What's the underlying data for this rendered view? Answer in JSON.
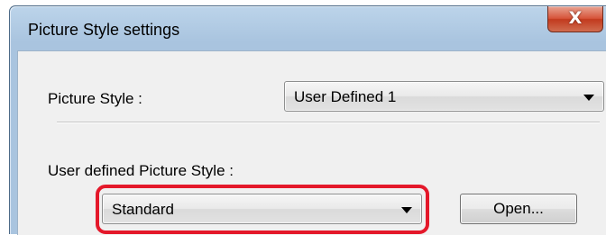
{
  "window": {
    "title": "Picture Style settings",
    "close_glyph": "X"
  },
  "picture_style": {
    "label": "Picture Style :",
    "selected": "User Defined 1"
  },
  "user_defined": {
    "label": "User defined Picture Style :",
    "selected": "Standard",
    "highlight_color": "#e4182a"
  },
  "open_button": {
    "label": "Open..."
  },
  "icons": {
    "close": "close-icon",
    "dropdown": "chevron-down-icon"
  }
}
